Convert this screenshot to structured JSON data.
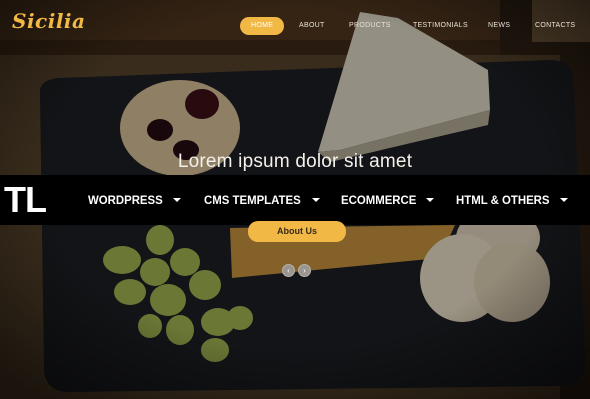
{
  "site": {
    "logo": "Sicilia",
    "nav": [
      {
        "label": "HOME",
        "active": true
      },
      {
        "label": "ABOUT",
        "active": false
      },
      {
        "label": "PRODUCTS",
        "active": false
      },
      {
        "label": "TESTIMONIALS",
        "active": false
      },
      {
        "label": "NEWS",
        "active": false
      },
      {
        "label": "CONTACTS",
        "active": false
      }
    ]
  },
  "hero": {
    "title": "Lorem ipsum dolor sit amet",
    "cta_label": "About Us",
    "prev_glyph": "‹",
    "next_glyph": "›"
  },
  "overlay": {
    "logo": "TL",
    "menus": [
      "WORDPRESS",
      "CMS TEMPLATES",
      "ECOMMERCE",
      "HTML & OTHERS"
    ]
  },
  "colors": {
    "accent": "#f2b845",
    "overlay_bg": "#000000",
    "text_light": "#f4f0ea"
  }
}
